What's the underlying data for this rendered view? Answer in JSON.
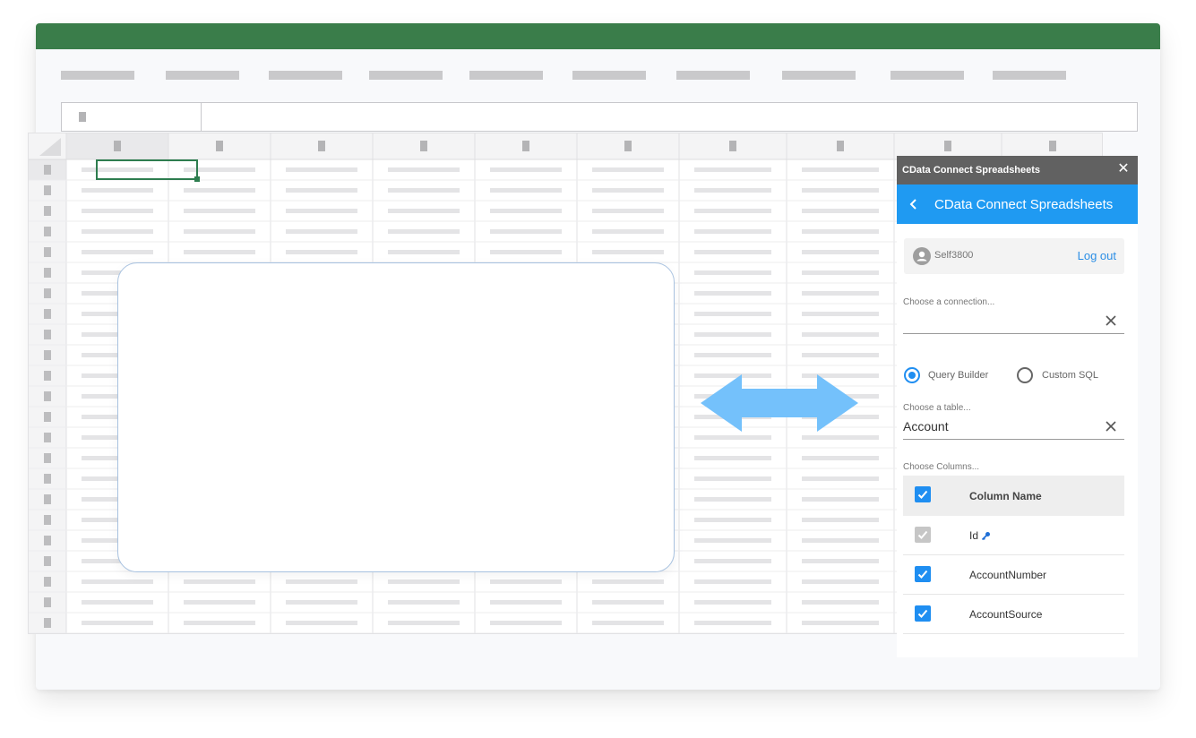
{
  "colors": {
    "title_strip": "#3a7d4a",
    "panel_accent": "#1f9af2",
    "panel_titlebar": "#616161",
    "checkbox_on": "#1f8ef1",
    "link": "#2b8ee5",
    "arrow": "#74c1fb",
    "selection": "#2e7d4f"
  },
  "panel": {
    "window_title": "CData Connect Spreadsheets",
    "close_icon": "close-icon",
    "header_title": "CData Connect Spreadsheets",
    "back_icon": "chevron-left-icon",
    "user": {
      "name": "Self3800",
      "logout": "Log out"
    },
    "connection": {
      "placeholder": "Choose a connection...",
      "value": ""
    },
    "modes": [
      {
        "label": "Query Builder",
        "selected": true
      },
      {
        "label": "Custom SQL",
        "selected": false
      }
    ],
    "table": {
      "placeholder": "Choose a table...",
      "value": "Account"
    },
    "columns": {
      "label": "Choose Columns...",
      "header": "Column Name",
      "rows": [
        {
          "name": "Id",
          "checked": true,
          "disabled": true,
          "key": true
        },
        {
          "name": "AccountNumber",
          "checked": true,
          "disabled": false,
          "key": false
        },
        {
          "name": "AccountSource",
          "checked": true,
          "disabled": false,
          "key": false
        }
      ]
    }
  }
}
